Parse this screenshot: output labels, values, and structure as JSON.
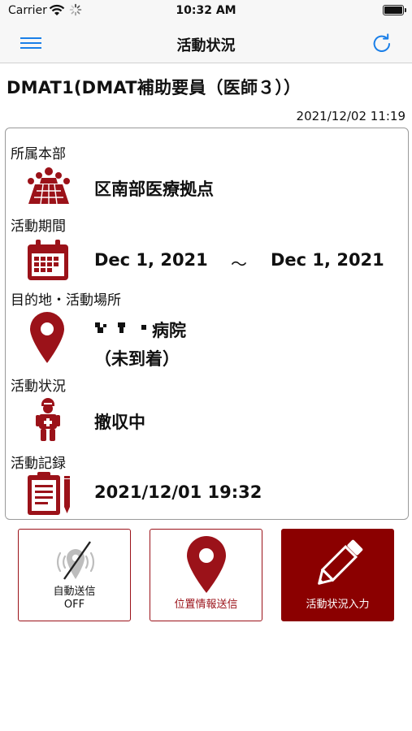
{
  "status_bar": {
    "carrier": "Carrier",
    "time": "10:32 AM"
  },
  "nav": {
    "title": "活動状況",
    "menu_icon": "hamburger-menu-icon",
    "refresh_icon": "refresh-icon"
  },
  "header": {
    "unit_title": "DMAT1(DMAT補助要員（医師３））",
    "updated_at": "2021/12/02 11:19"
  },
  "sections": {
    "affiliation": {
      "label": "所属本部",
      "value": "区南部医療拠点",
      "icon": "headquarters-group-icon"
    },
    "period": {
      "label": "活動期間",
      "start": "Dec 1, 2021",
      "separator": "～",
      "end": "Dec 1, 2021",
      "icon": "calendar-icon"
    },
    "destination": {
      "label": "目的地・活動場所",
      "value_suffix": "病院",
      "arrival": "（未到着）",
      "icon": "location-pin-icon"
    },
    "status": {
      "label": "活動状況",
      "value": "撤収中",
      "icon": "medical-worker-icon"
    },
    "record": {
      "label": "活動記録",
      "value": "2021/12/01 19:32",
      "icon": "clipboard-record-icon"
    }
  },
  "buttons": {
    "auto_send": {
      "label_line1": "自動送信",
      "label_line2": "OFF",
      "icon": "location-off-icon"
    },
    "send_location": {
      "label": "位置情報送信",
      "icon": "location-pin-icon"
    },
    "status_input": {
      "label": "活動状況入力",
      "icon": "pencil-icon"
    }
  },
  "colors": {
    "accent_red": "#9b1219",
    "dark_red": "#8b0000",
    "ios_blue": "#1a7fe8"
  }
}
